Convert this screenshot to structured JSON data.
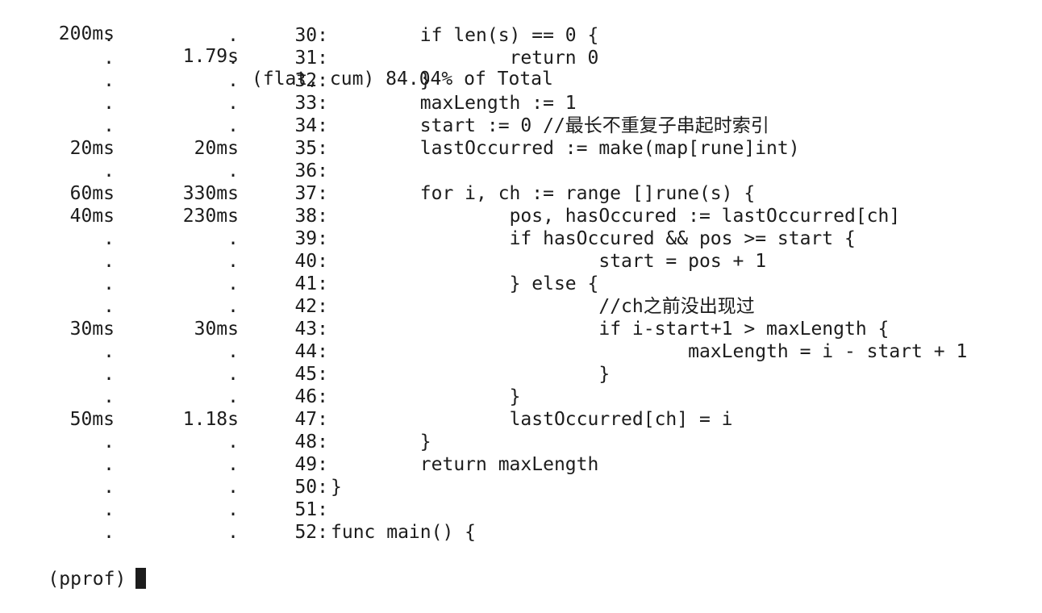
{
  "header": {
    "flat": "200ms",
    "cum": "1.79s",
    "text": "(flat, cum) 84.04% of Total"
  },
  "rows": [
    {
      "flat": ".",
      "cum": ".",
      "lineno": "30:",
      "code": "\tif len(s) == 0 {"
    },
    {
      "flat": ".",
      "cum": ".",
      "lineno": "31:",
      "code": "\t\treturn 0"
    },
    {
      "flat": ".",
      "cum": ".",
      "lineno": "32:",
      "code": "\t}"
    },
    {
      "flat": ".",
      "cum": ".",
      "lineno": "33:",
      "code": "\tmaxLength := 1"
    },
    {
      "flat": ".",
      "cum": ".",
      "lineno": "34:",
      "code": "\tstart := 0 //最长不重复子串起时索引"
    },
    {
      "flat": "20ms",
      "cum": "20ms",
      "lineno": "35:",
      "code": "\tlastOccurred := make(map[rune]int)"
    },
    {
      "flat": ".",
      "cum": ".",
      "lineno": "36:",
      "code": ""
    },
    {
      "flat": "60ms",
      "cum": "330ms",
      "lineno": "37:",
      "code": "\tfor i, ch := range []rune(s) {"
    },
    {
      "flat": "40ms",
      "cum": "230ms",
      "lineno": "38:",
      "code": "\t\tpos, hasOccured := lastOccurred[ch]"
    },
    {
      "flat": ".",
      "cum": ".",
      "lineno": "39:",
      "code": "\t\tif hasOccured && pos >= start {"
    },
    {
      "flat": ".",
      "cum": ".",
      "lineno": "40:",
      "code": "\t\t\tstart = pos + 1"
    },
    {
      "flat": ".",
      "cum": ".",
      "lineno": "41:",
      "code": "\t\t} else {"
    },
    {
      "flat": ".",
      "cum": ".",
      "lineno": "42:",
      "code": "\t\t\t//ch之前没出现过"
    },
    {
      "flat": "30ms",
      "cum": "30ms",
      "lineno": "43:",
      "code": "\t\t\tif i-start+1 > maxLength {"
    },
    {
      "flat": ".",
      "cum": ".",
      "lineno": "44:",
      "code": "\t\t\t\tmaxLength = i - start + 1"
    },
    {
      "flat": ".",
      "cum": ".",
      "lineno": "45:",
      "code": "\t\t\t}"
    },
    {
      "flat": ".",
      "cum": ".",
      "lineno": "46:",
      "code": "\t\t}"
    },
    {
      "flat": "50ms",
      "cum": "1.18s",
      "lineno": "47:",
      "code": "\t\tlastOccurred[ch] = i"
    },
    {
      "flat": ".",
      "cum": ".",
      "lineno": "48:",
      "code": "\t}"
    },
    {
      "flat": ".",
      "cum": ".",
      "lineno": "49:",
      "code": "\treturn maxLength"
    },
    {
      "flat": ".",
      "cum": ".",
      "lineno": "50:",
      "code": "}"
    },
    {
      "flat": ".",
      "cum": ".",
      "lineno": "51:",
      "code": ""
    },
    {
      "flat": ".",
      "cum": ".",
      "lineno": "52:",
      "code": "func main() {"
    }
  ],
  "prompt": "(pprof)"
}
